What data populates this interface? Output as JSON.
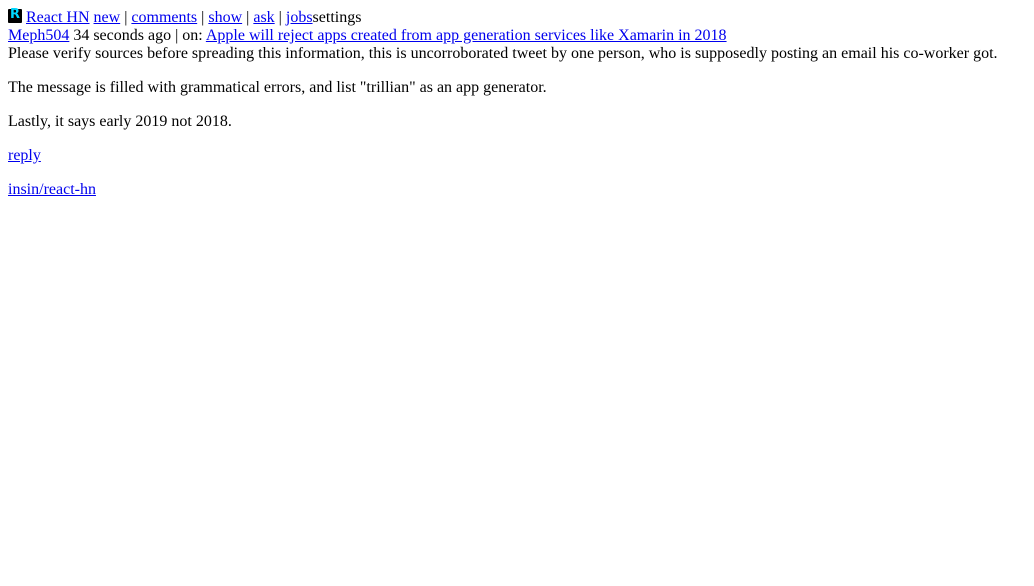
{
  "header": {
    "logo_letter": "R",
    "site_title": "React HN",
    "nav": {
      "new": "new",
      "comments": "comments",
      "show": "show",
      "ask": "ask",
      "jobs": "jobs",
      "separator": " | ",
      "settings": "settings"
    }
  },
  "comment": {
    "author": "Meph504",
    "age": " 34 seconds ago | on: ",
    "story_title": "Apple will reject apps created from app generation services like Xamarin in 2018",
    "paragraphs": [
      "Please verify sources before spreading this information, this is uncorroborated tweet by one person, who is supposedly posting an email his co-worker got.",
      "The message is filled with grammatical errors, and list \"trillian\" as an app generator.",
      "Lastly, it says early 2019 not 2018."
    ],
    "reply_label": "reply"
  },
  "footer": {
    "repo_link": "insin/react-hn"
  },
  "colors": {
    "link": "#0000ee",
    "logo_bg": "#000000",
    "logo_fg": "#00d8ff"
  }
}
